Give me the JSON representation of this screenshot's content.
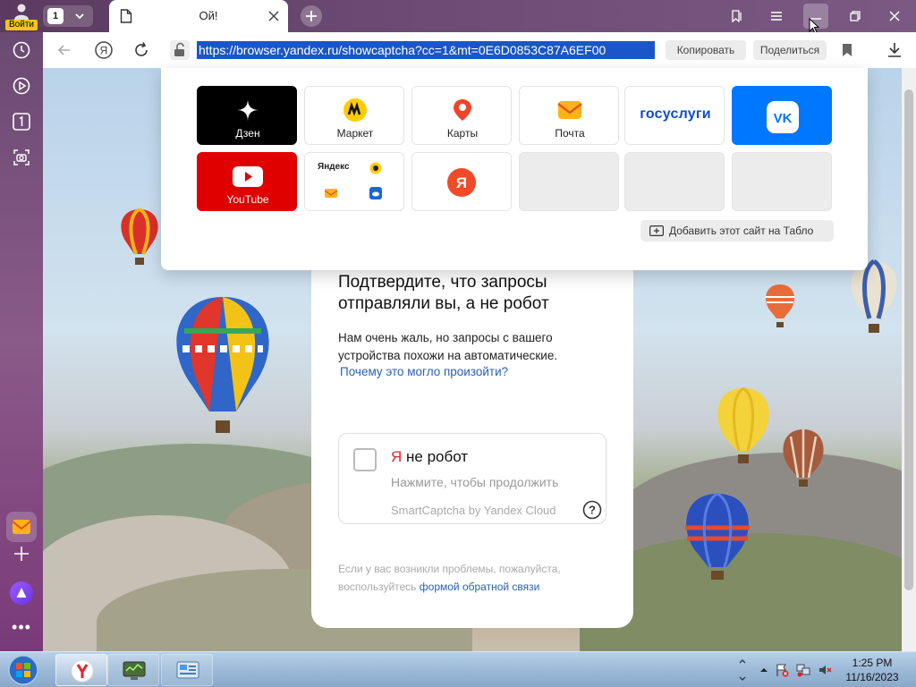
{
  "profile": {
    "login_label": "Войти"
  },
  "tabs": {
    "count": "1",
    "active_title": "Ой!"
  },
  "addressbar": {
    "url": "https://browser.yandex.ru/showcaptcha?cc=1&mt=0E6D0853C87A6EF00",
    "copy_label": "Копировать",
    "share_label": "Поделиться"
  },
  "tableau": {
    "tiles": [
      {
        "label": "Дзен",
        "icon": "zen-star-icon"
      },
      {
        "label": "Маркет",
        "icon": "market-icon"
      },
      {
        "label": "Карты",
        "icon": "maps-pin-icon"
      },
      {
        "label": "Почта",
        "icon": "mail-envelope-icon"
      },
      {
        "label": "госуслуги",
        "icon": "gosuslugi-logo"
      },
      {
        "label": "VK",
        "icon": "vk-logo"
      },
      {
        "label": "YouTube",
        "icon": "youtube-play-icon"
      },
      {
        "label": "Яндекс",
        "icon": "yandex-apps-group"
      },
      {
        "label": "Я",
        "icon": "yandex-ya-icon"
      }
    ],
    "add_site_label": "Добавить этот сайт на Табло"
  },
  "captcha": {
    "title": "Подтвердите, что запросы отправляли вы, а не робот",
    "description": "Нам очень жаль, но запросы с вашего устройства похожи на автоматические.",
    "why_link": "Почему это могло произойти?",
    "checkbox_ya": "Я",
    "checkbox_label": " не робот",
    "hint": "Нажмите, чтобы продолжить",
    "brand": "SmartCaptcha by Yandex Cloud",
    "footer_text": "Если у вас возникли проблемы, пожалуйста, воспользуйтесь ",
    "footer_link": "формой обратной связи"
  },
  "taskbar": {
    "time": "1:25 PM",
    "date": "11/16/2023"
  },
  "colors": {
    "accent": "#1a56c8",
    "yandex_red": "#e6242c",
    "vk_blue": "#0077ff",
    "youtube_red": "#e00000",
    "zen_black": "#000000"
  }
}
